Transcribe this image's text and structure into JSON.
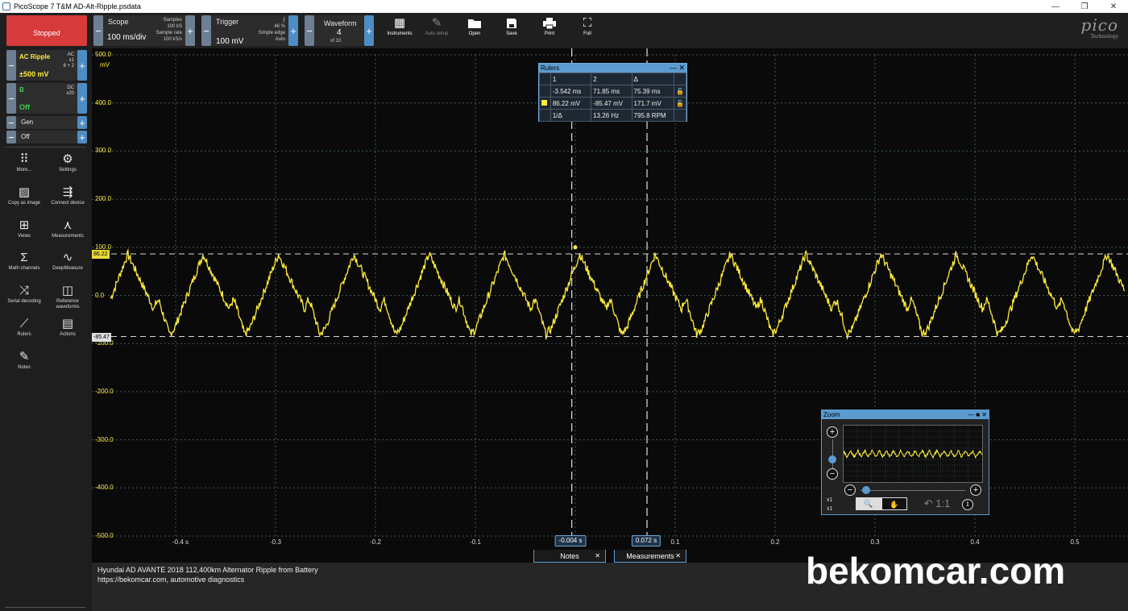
{
  "window": {
    "title": "PicoScope 7 T&M AD-Alt-Ripple.psdata",
    "minimize": "—",
    "restore": "❐",
    "close": "✕"
  },
  "toolbar": {
    "run_state": "Stopped",
    "scope": {
      "title": "Scope",
      "timebase": "100 ms/div",
      "samples_label": "Samples",
      "samples_value": "100 kS",
      "rate_label": "Sample rate",
      "rate_value": "100 kS/s"
    },
    "trigger": {
      "title": "Trigger",
      "level": "100 mV",
      "edge_symbol": "⨍",
      "percent": "46 %",
      "type": "Simple edge",
      "mode": "Auto"
    },
    "waveform": {
      "title": "Waveform",
      "current": "4",
      "of": "of 10"
    },
    "buttons": {
      "instruments": "Instruments",
      "auto_setup": "Auto setup",
      "open": "Open",
      "save": "Save",
      "print": "Print",
      "full": "Full"
    },
    "logo": {
      "word": "pico",
      "sub": "Technology"
    }
  },
  "channels": [
    {
      "name": "AC Ripple",
      "range": "±500 mV",
      "coupling": "AC",
      "probe": "x1",
      "extra": "8 + 2",
      "color": "#ffeb3b"
    },
    {
      "name": "B",
      "range": "Off",
      "coupling": "DC",
      "probe": "x20",
      "color": "#3ccf4e"
    }
  ],
  "generator": {
    "label": "Gen",
    "state": "Off"
  },
  "tools": [
    {
      "label": "More...",
      "icon": "dots-icon"
    },
    {
      "label": "Settings",
      "icon": "gear-icon"
    },
    {
      "label": "Copy as image",
      "icon": "image-icon"
    },
    {
      "label": "Connect device",
      "icon": "usb-icon"
    },
    {
      "label": "Views",
      "icon": "grid-icon"
    },
    {
      "label": "Measurements",
      "icon": "caliper-icon"
    },
    {
      "label": "Math channels",
      "icon": "sigma-icon"
    },
    {
      "label": "DeepMeasure",
      "icon": "wave-icon"
    },
    {
      "label": "Serial decoding",
      "icon": "serial-icon"
    },
    {
      "label": "Reference waveforms",
      "icon": "reference-icon"
    },
    {
      "label": "Rulers",
      "icon": "ruler-icon"
    },
    {
      "label": "Actions",
      "icon": "clapper-icon"
    },
    {
      "label": "Notes",
      "icon": "notes-icon"
    }
  ],
  "plot": {
    "y_unit": "mV",
    "y_ticks": [
      "500.0",
      "400.0",
      "300.0",
      "200.0",
      "100.0",
      "0.0",
      "-100.0",
      "-200.0",
      "-300.0",
      "-400.0",
      "-500.0"
    ],
    "x_ticks": [
      "-0.4 s",
      "-0.3",
      "-0.2",
      "-0.1",
      "0.1",
      "0.2",
      "0.3",
      "0.4",
      "0.5"
    ],
    "signal_color": "#ffeb3b",
    "amplitude_rulers": [
      "86.22",
      "-85.47"
    ],
    "time_rulers": [
      "-0.004 s",
      "0.072 s"
    ]
  },
  "rulers_panel": {
    "title": "Rulers",
    "headers": [
      "1",
      "2",
      "Δ"
    ],
    "time_row": [
      "-3.542 ms",
      "71.85 ms",
      "75.39 ms"
    ],
    "amp_row": [
      "86.22 mV",
      "-85.47 mV",
      "171.7 mV"
    ],
    "freq_label": "1/Δ",
    "freq": "13.26 Hz",
    "rpm": "795.8 RPM"
  },
  "zoom_panel": {
    "title": "Zoom",
    "x1": "x1",
    "x2": "x1",
    "ratio": "1:1",
    "info": "i"
  },
  "tabs": {
    "notes": "Notes",
    "measurements": "Measurements"
  },
  "notes": {
    "line1": "Hyundai AD AVANTE 2018 112,400km Alternator Ripple from Battery",
    "line2": "https://bekomcar.com, automotive diagnostics"
  },
  "watermark": "bekomcar.com"
}
